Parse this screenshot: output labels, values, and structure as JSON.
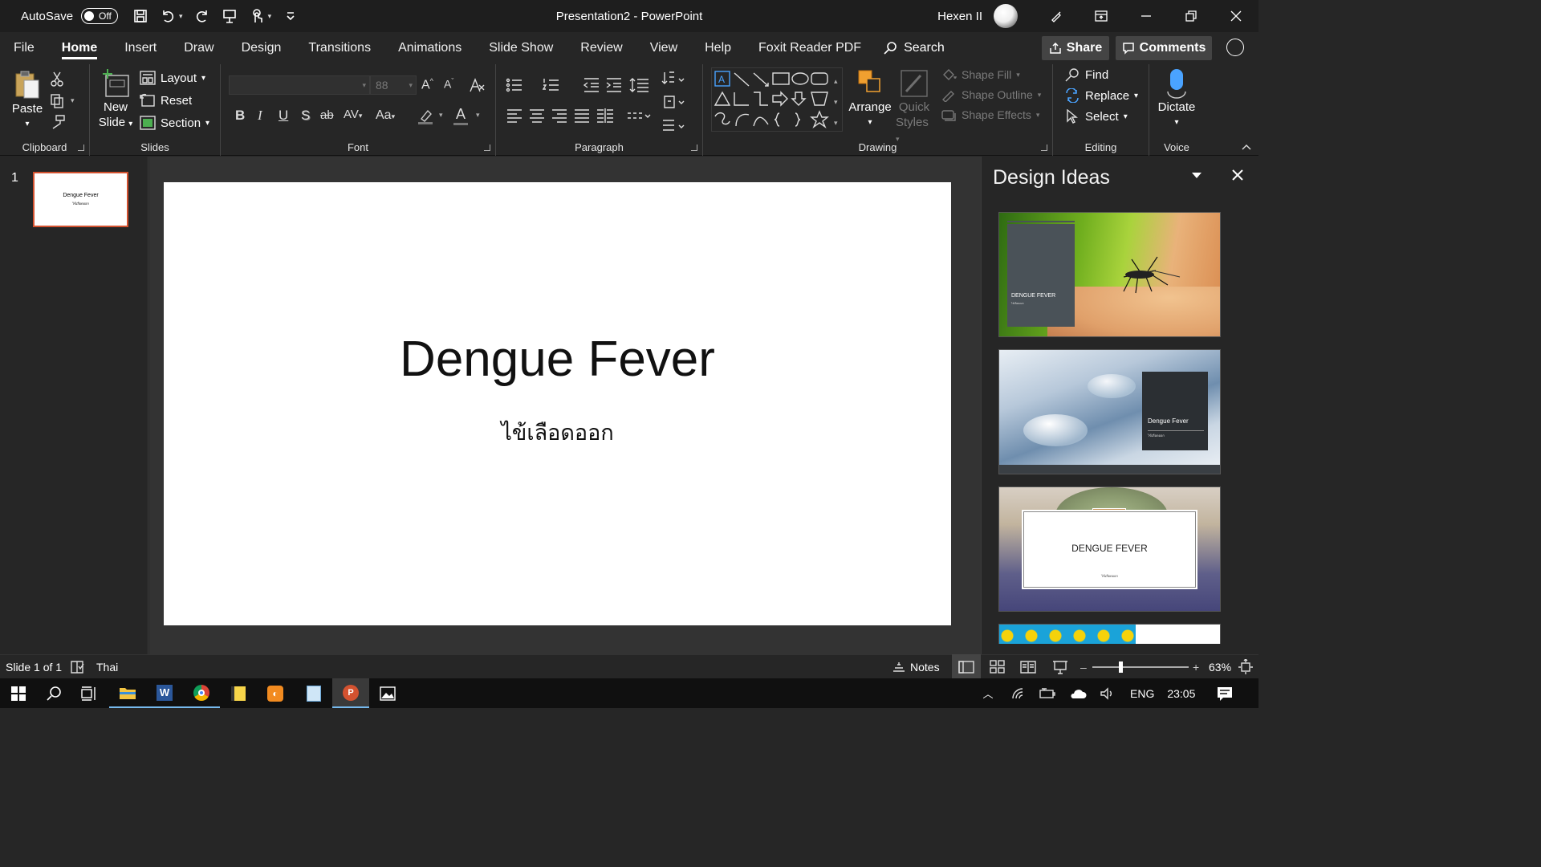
{
  "titlebar": {
    "autosave_label": "AutoSave",
    "autosave_state": "Off",
    "title": "Presentation2  -  PowerPoint",
    "user_name": "Hexen II"
  },
  "tabs": [
    {
      "label": "File"
    },
    {
      "label": "Home",
      "active": true
    },
    {
      "label": "Insert"
    },
    {
      "label": "Draw"
    },
    {
      "label": "Design"
    },
    {
      "label": "Transitions"
    },
    {
      "label": "Animations"
    },
    {
      "label": "Slide Show"
    },
    {
      "label": "Review"
    },
    {
      "label": "View"
    },
    {
      "label": "Help"
    },
    {
      "label": "Foxit Reader PDF"
    }
  ],
  "search": {
    "label": "Search"
  },
  "share": {
    "label": "Share"
  },
  "comments": {
    "label": "Comments"
  },
  "ribbon": {
    "clipboard": {
      "label": "Clipboard",
      "paste": "Paste"
    },
    "slides": {
      "label": "Slides",
      "new_slide_1": "New",
      "new_slide_2": "Slide",
      "layout": "Layout",
      "reset": "Reset",
      "section": "Section"
    },
    "font": {
      "label": "Font",
      "font_size": "88",
      "bold": "B",
      "italic": "I",
      "underline": "U",
      "shadow": "S",
      "strike": "ab",
      "spacing": "AV",
      "case": "Aa",
      "grow": "A",
      "shrink": "A"
    },
    "paragraph": {
      "label": "Paragraph"
    },
    "drawing": {
      "label": "Drawing",
      "arrange": "Arrange",
      "quick_styles_1": "Quick",
      "quick_styles_2": "Styles",
      "shape_fill": "Shape Fill",
      "shape_outline": "Shape Outline",
      "shape_effects": "Shape Effects"
    },
    "editing": {
      "label": "Editing",
      "find": "Find",
      "replace": "Replace",
      "select": "Select"
    },
    "voice": {
      "label": "Voice",
      "dictate": "Dictate"
    }
  },
  "slides_panel": {
    "slide_number": "1",
    "thumb_title": "Dengue Fever",
    "thumb_subtitle": "ไข้เลือดออก"
  },
  "slide": {
    "title": "Dengue Fever",
    "subtitle": "ไข้เลือดออก"
  },
  "design_ideas": {
    "title": "Design Ideas",
    "idea1_title": "DENGUE FEVER",
    "idea1_sub": "ไข้เลือดออก",
    "idea2_title": "Dengue Fever",
    "idea2_sub": "ไข้เลือดออก",
    "idea3_title": "DENGUE FEVER",
    "idea3_sub": "ไข้เลือดออก"
  },
  "status": {
    "slide_info": "Slide 1 of 1",
    "language": "Thai",
    "notes": "Notes",
    "zoom": "63%",
    "zoom_level": 0.63
  },
  "taskbar": {
    "language": "ENG",
    "time": "23:05"
  },
  "colors": {
    "accent_powerpoint": "#d35230",
    "ribbon_bg": "#262626",
    "titlebar_bg": "#1e1e1e"
  }
}
